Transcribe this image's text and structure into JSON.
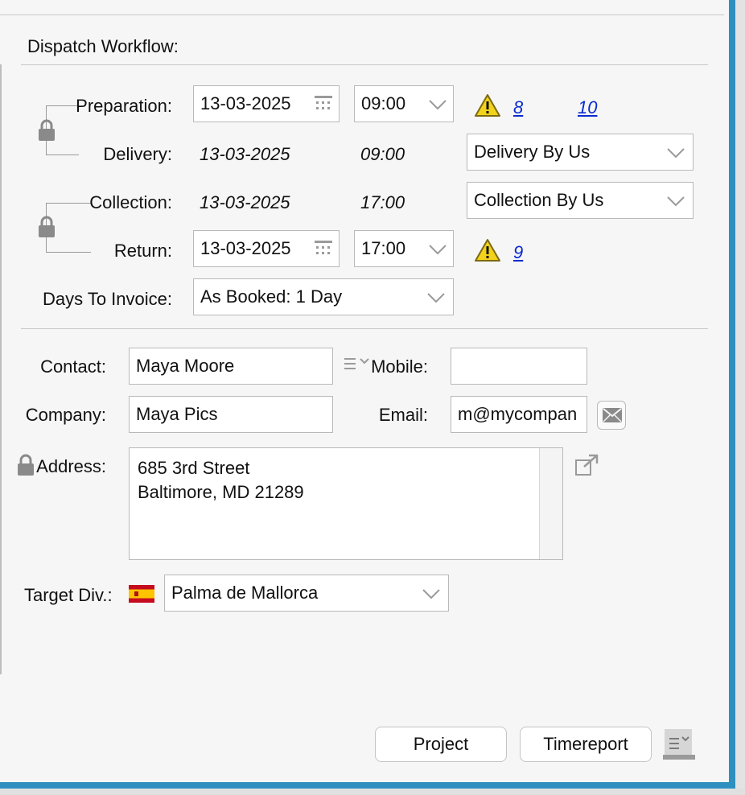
{
  "section_title": "Dispatch Workflow:",
  "preparation": {
    "label": "Preparation:",
    "date": "13-03-2025",
    "time": "09:00",
    "warning_link_1": "8",
    "warning_link_2": "10"
  },
  "delivery": {
    "label": "Delivery:",
    "date": "13-03-2025",
    "time": "09:00",
    "method": "Delivery By Us"
  },
  "collection": {
    "label": "Collection:",
    "date": "13-03-2025",
    "time": "17:00",
    "method": "Collection By Us"
  },
  "return": {
    "label": "Return:",
    "date": "13-03-2025",
    "time": "17:00",
    "warning_link": "9"
  },
  "days_to_invoice": {
    "label": "Days To Invoice:",
    "value": "As Booked: 1 Day"
  },
  "contact": {
    "label": "Contact:",
    "value": "Maya Moore"
  },
  "mobile": {
    "label": "Mobile:",
    "value": ""
  },
  "company": {
    "label": "Company:",
    "value": "Maya Pics"
  },
  "email": {
    "label": "Email:",
    "value": "m@mycompan"
  },
  "address": {
    "label": "Address:",
    "line1": "685 3rd Street",
    "line2": "Baltimore, MD 21289"
  },
  "target_div": {
    "label": "Target Div.:",
    "value": "Palma de Mallorca",
    "flag_icon": "spain-flag-icon"
  },
  "buttons": {
    "project": "Project",
    "timereport": "Timereport"
  },
  "colors": {
    "accent_frame": "#2f8fbf",
    "link": "#0b2bd0",
    "warning": "#f2d21b"
  }
}
